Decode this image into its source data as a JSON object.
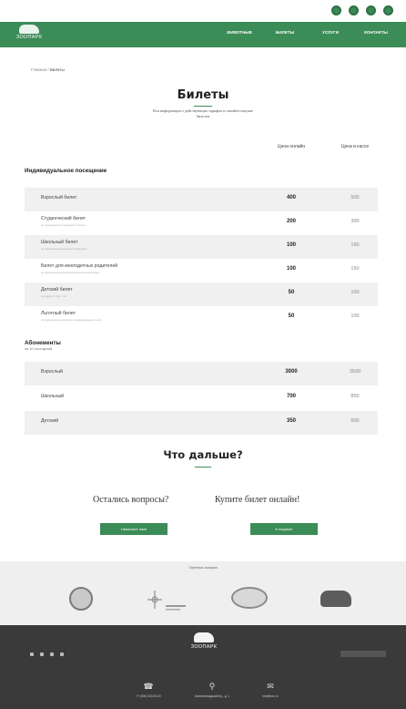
{
  "header": {
    "logo_text": "ЗООПАРК",
    "nav": [
      "Животные",
      "Билеты",
      "Услуги",
      "Контакты"
    ]
  },
  "breadcrumbs": {
    "home": "Главная",
    "separator": "/",
    "current": "Билеты"
  },
  "page": {
    "title": "Билеты",
    "subtitle": "Вся информация о действующих тарифах и онлайн-покупке билетов"
  },
  "columns": {
    "online": "Цена онлайн",
    "cashier": "Цена в кассе"
  },
  "individual": {
    "heading": "Индивидуальное посещение",
    "rows": [
      {
        "name": "Взрослый билет",
        "note": "",
        "online": "400",
        "cashier": "500"
      },
      {
        "name": "Студенческий билет",
        "note": "по предъявлению студенческого билета",
        "online": "200",
        "cashier": "300"
      },
      {
        "name": "Школьный билет",
        "note": "по предъявлению документа об обучении",
        "online": "100",
        "cashier": "150"
      },
      {
        "name": "Билет для многодетных родителей",
        "note": "по предъявлению удостоверения многодетной семьи",
        "online": "100",
        "cashier": "150"
      },
      {
        "name": "Детский билет",
        "note": "для детей от 3 до 7 лет",
        "online": "50",
        "cashier": "100"
      },
      {
        "name": "Льготный билет",
        "note": "по предъявлению документа, подтверждающего льготу",
        "online": "50",
        "cashier": "100"
      }
    ]
  },
  "subscriptions": {
    "heading": "Абонементы",
    "subheading": "на 10 посещений",
    "rows": [
      {
        "name": "Взрослый",
        "online": "3000",
        "cashier": "3500"
      },
      {
        "name": "Школьный",
        "online": "700",
        "cashier": "850"
      },
      {
        "name": "Детский",
        "online": "350",
        "cashier": "500"
      }
    ]
  },
  "whats_next": {
    "title": "Что дальше?",
    "question_left": "Остались вопросы?",
    "question_right": "Купите билет онлайн!",
    "button_left": "Напишите нам!",
    "button_right": "К покупке!"
  },
  "partners": {
    "title": "Партнёры зоопарка"
  },
  "footer": {
    "logo_text": "ЗООПАРК",
    "phone": "+7 (000) 000-00-00",
    "address": "Калининградский пр., д. 1",
    "email": "info@zoo.ru"
  },
  "colors": {
    "brand_green": "#3b8c57",
    "footer_dark": "#3a3a3a",
    "row_shade": "#f0f0f0"
  }
}
